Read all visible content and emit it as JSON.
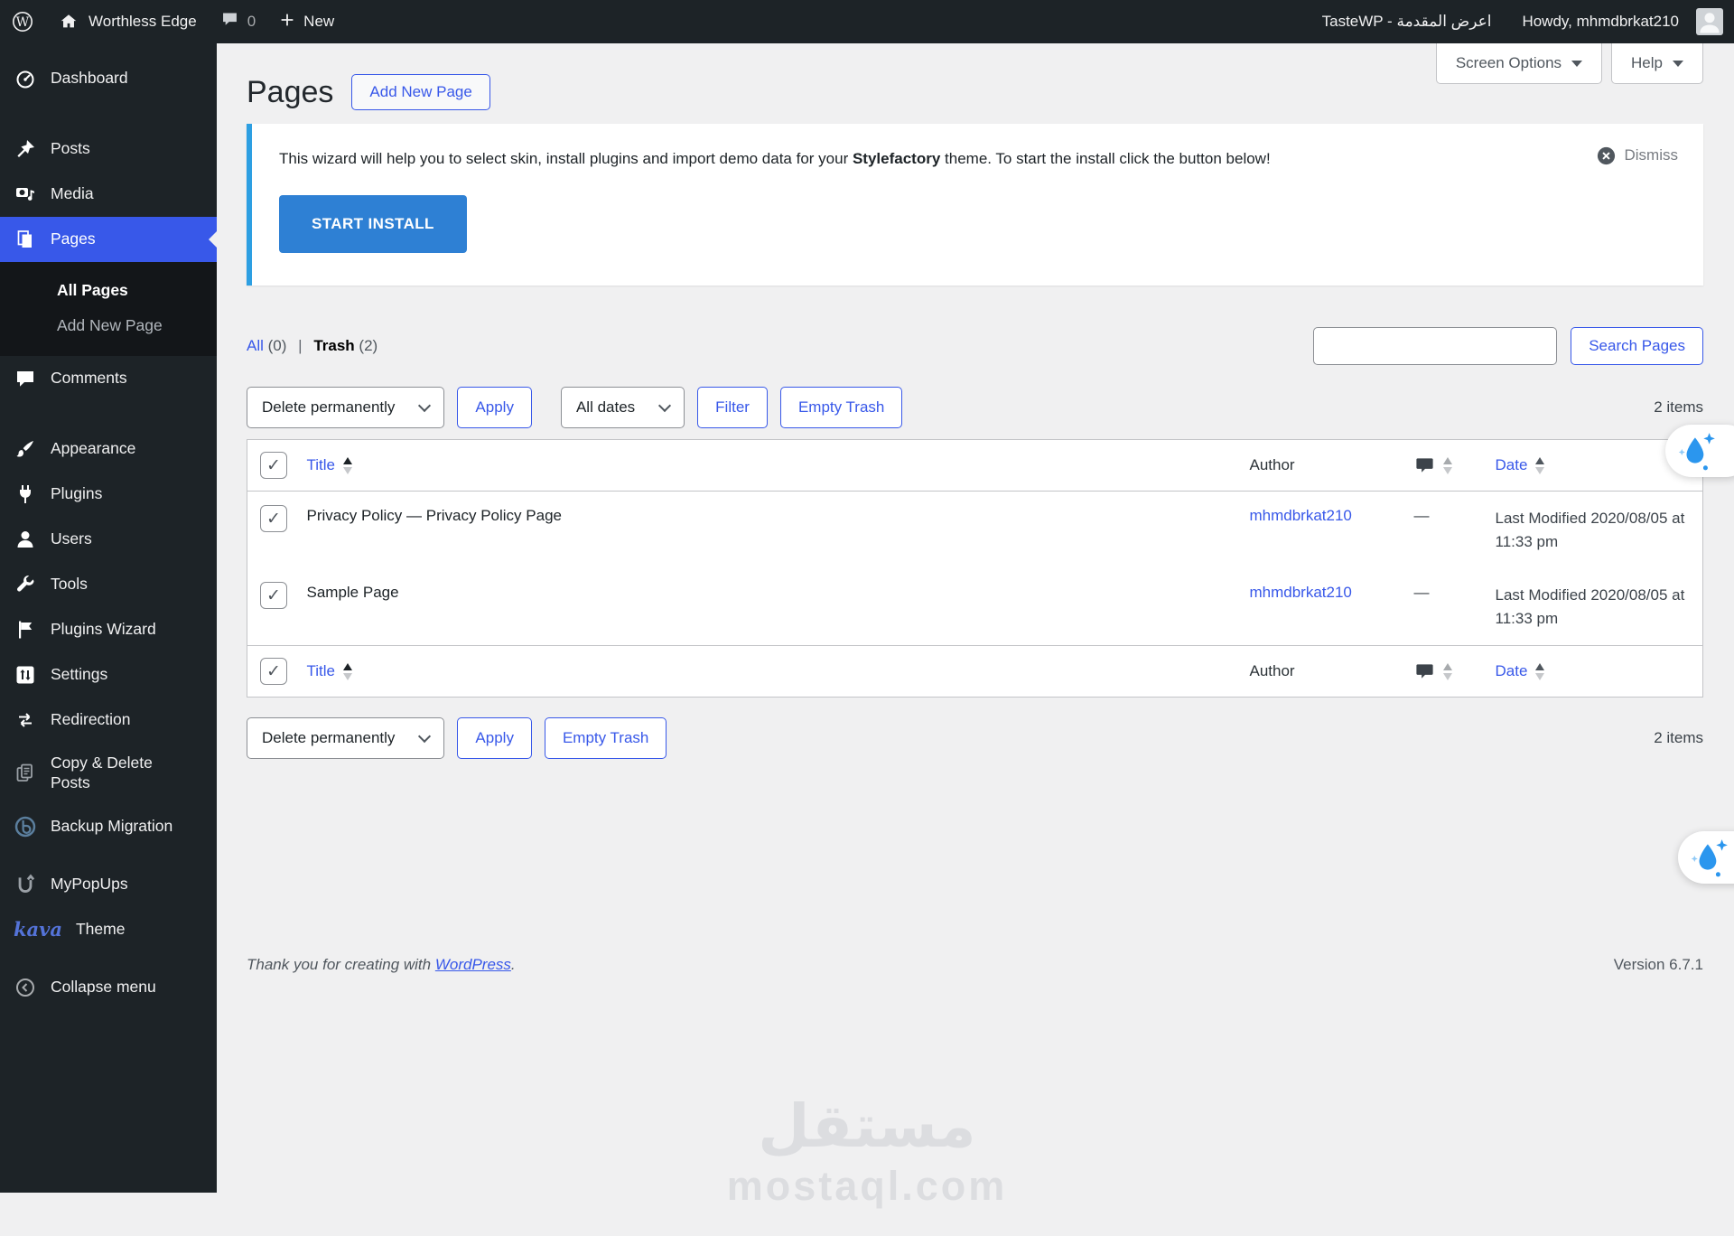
{
  "admin_bar": {
    "site_name": "Worthless Edge",
    "comments_count": "0",
    "new_label": "New",
    "tastewp_label": "TasteWP - اعرض المقدمة",
    "howdy_label": "Howdy, mhmdbrkat210"
  },
  "sidebar": {
    "items": [
      {
        "label": "Dashboard"
      },
      {
        "label": "Posts"
      },
      {
        "label": "Media"
      },
      {
        "label": "Pages"
      },
      {
        "label": "Comments"
      },
      {
        "label": "Appearance"
      },
      {
        "label": "Plugins"
      },
      {
        "label": "Users"
      },
      {
        "label": "Tools"
      },
      {
        "label": "Plugins Wizard"
      },
      {
        "label": "Settings"
      },
      {
        "label": "Redirection"
      },
      {
        "label": "Copy & Delete Posts"
      },
      {
        "label": "Backup Migration"
      },
      {
        "label": "MyPopUps"
      }
    ],
    "submenu": [
      {
        "label": "All Pages"
      },
      {
        "label": "Add New Page"
      }
    ],
    "kava_logo": "kava",
    "kava_theme_label": "Theme",
    "collapse_label": "Collapse menu"
  },
  "page": {
    "title": "Pages",
    "add_new_label": "Add New Page",
    "screen_options_label": "Screen Options",
    "help_label": "Help"
  },
  "notice": {
    "text_before": "This wizard will help you to select skin, install plugins and import demo data for your ",
    "theme_name": "Stylefactory",
    "text_after": " theme. To start the install click the button below!",
    "dismiss_label": "Dismiss",
    "install_label": "START INSTALL"
  },
  "filters": {
    "all_label": "All",
    "all_count": "(0)",
    "separator": "|",
    "trash_label": "Trash",
    "trash_count": "(2)",
    "search_value": "",
    "search_button_label": "Search Pages",
    "bulk_action_value": "Delete permanently",
    "apply_label": "Apply",
    "date_filter_value": "All dates",
    "filter_label": "Filter",
    "empty_trash_label": "Empty Trash",
    "items_count": "2 items"
  },
  "table": {
    "headers": {
      "title": "Title",
      "author": "Author",
      "date": "Date"
    },
    "rows": [
      {
        "title": "Privacy Policy — Privacy Policy Page",
        "author": "mhmdbrkat210",
        "comments": "—",
        "date": "Last Modified 2020/08/05 at 11:33 pm"
      },
      {
        "title": "Sample Page",
        "author": "mhmdbrkat210",
        "comments": "—",
        "date": "Last Modified 2020/08/05 at 11:33 pm"
      }
    ]
  },
  "footer": {
    "thanks_prefix": "Thank you for creating with ",
    "wordpress_link_label": "WordPress",
    "thanks_suffix": ".",
    "version_label": "Version 6.7.1"
  },
  "watermark": {
    "arabic": "مستقل",
    "latin": "mostaql.com"
  },
  "colors": {
    "accent": "#3858e9",
    "install_button": "#2e80d4",
    "notice_border": "#2d9fe2",
    "active_menu": "#3858e9",
    "drop_icon": "#2b96ee",
    "admin_dark": "#1d2327",
    "content_bg": "#f0f0f1"
  }
}
